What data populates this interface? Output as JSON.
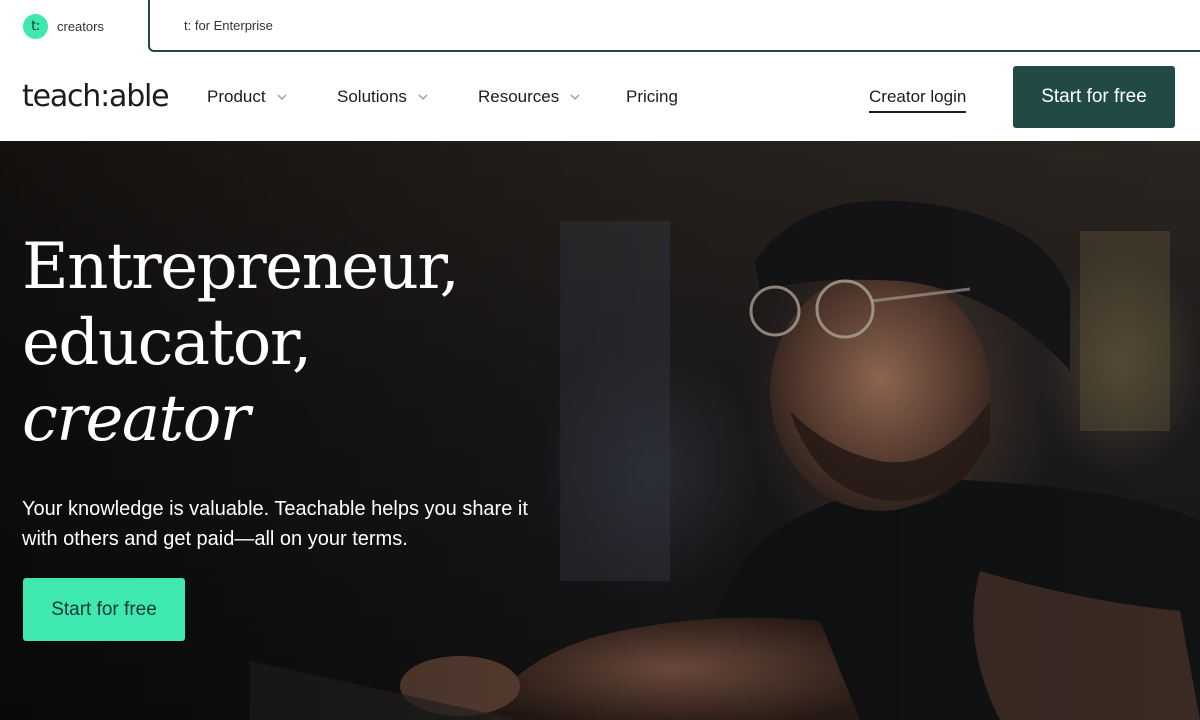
{
  "audience_bar": {
    "creators": {
      "logo": "t:",
      "label": "creators"
    },
    "enterprise": {
      "label": "t: for Enterprise"
    }
  },
  "nav": {
    "brand": "teach:able",
    "items": [
      {
        "label": "Product",
        "has_dropdown": true,
        "icon": "chevron-down-icon"
      },
      {
        "label": "Solutions",
        "has_dropdown": true,
        "icon": "chevron-down-icon"
      },
      {
        "label": "Resources",
        "has_dropdown": true,
        "icon": "chevron-down-icon"
      },
      {
        "label": "Pricing",
        "has_dropdown": false
      }
    ],
    "login": "Creator login",
    "cta": "Start for free"
  },
  "hero": {
    "title_lines": [
      "Entrepreneur,",
      "educator,",
      "creator"
    ],
    "subtitle": "Your knowledge is valuable. Teachable helps you share it with others and get paid—all on your terms.",
    "cta": "Start for free"
  },
  "colors": {
    "brand_dark": "#204a43",
    "accent_mint": "#3ee8b0",
    "text": "#1c1c1c",
    "hero_text": "#ffffff"
  }
}
